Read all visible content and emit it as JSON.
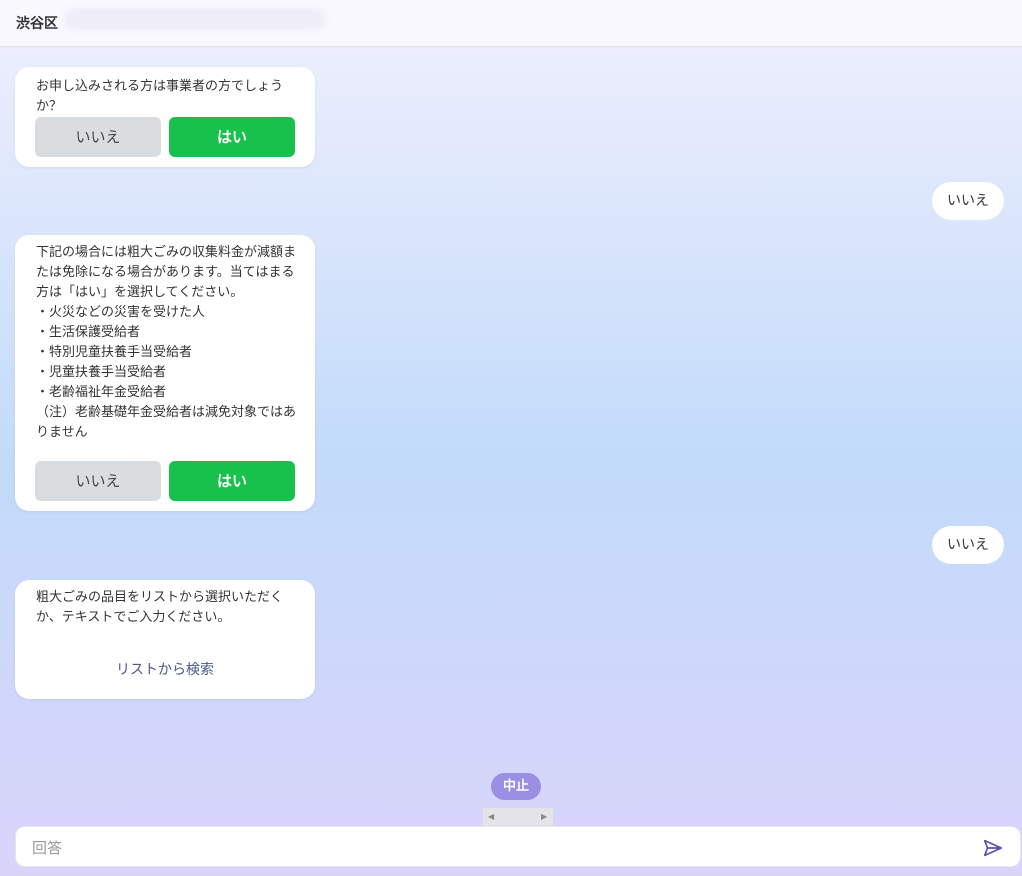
{
  "header": {
    "title": "渋谷区"
  },
  "messages": {
    "q1": {
      "text": "お申し込みされる方は事業者の方でしょうか？",
      "no_label": "いいえ",
      "yes_label": "はい"
    },
    "reply1": "いいえ",
    "q2": {
      "text": "下記の場合には粗大ごみの収集料金が減額または免除になる場合があります。当てはまる方は「はい」を選択してください。\n・火災などの災害を受けた人\n・生活保護受給者\n・特別児童扶養手当受給者\n・児童扶養手当受給者\n・老齢福祉年金受給者\n（注）老齢基礎年金受給者は減免対象ではありません",
      "no_label": "いいえ",
      "yes_label": "はい"
    },
    "reply2": "いいえ",
    "q3": {
      "text": "粗大ごみの品目をリストから選択いただくか、テキストでご入力ください。",
      "link_label": "リストから検索"
    }
  },
  "controls": {
    "stop_label": "中止"
  },
  "input": {
    "placeholder": "回答",
    "value": ""
  },
  "icons": {
    "send": "send-icon",
    "scroll_left": "chevron-left-icon",
    "scroll_right": "chevron-right-icon"
  },
  "colors": {
    "yes_button": "#18c14b",
    "no_button": "#dadde0",
    "stop_button": "#9a8fe3",
    "send_icon": "#5b4bb5",
    "link_text": "#4a5a8c"
  }
}
